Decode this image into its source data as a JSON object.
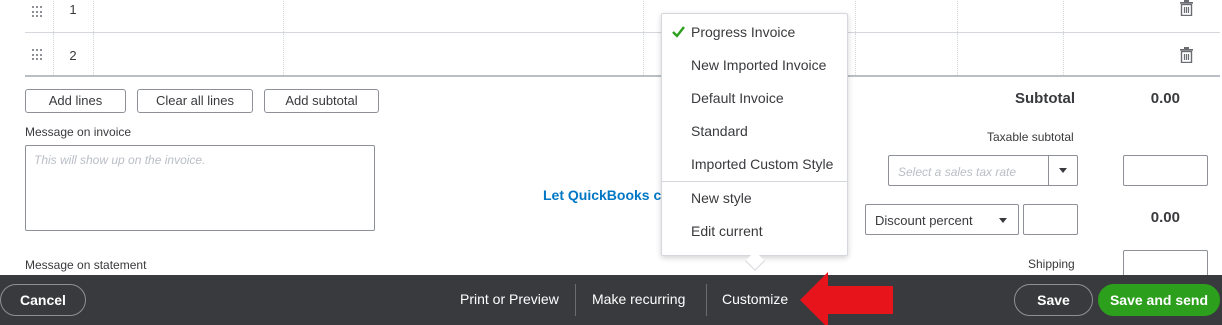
{
  "table": {
    "rows": [
      {
        "num": "1"
      },
      {
        "num": "2"
      }
    ]
  },
  "actions": {
    "add_lines": "Add lines",
    "clear_all_lines": "Clear all lines",
    "add_subtotal": "Add subtotal"
  },
  "message_invoice": {
    "label": "Message on invoice",
    "placeholder": "This will show up on the invoice."
  },
  "message_statement": {
    "label": "Message on statement"
  },
  "promo_link": "Let QuickBooks ca",
  "totals": {
    "subtotal_label": "Subtotal",
    "subtotal_value": "0.00",
    "taxable_label": "Taxable subtotal",
    "tax_rate_placeholder": "Select a sales tax rate",
    "discount_type": "Discount percent",
    "discount_value": "0.00",
    "shipping_label": "Shipping"
  },
  "customize_menu": {
    "items": [
      {
        "label": "Progress Invoice",
        "selected": true
      },
      {
        "label": "New Imported Invoice",
        "selected": false
      },
      {
        "label": "Default Invoice",
        "selected": false
      },
      {
        "label": "Standard",
        "selected": false
      },
      {
        "label": "Imported Custom Style",
        "selected": false
      },
      {
        "label": "New style",
        "selected": false
      },
      {
        "label": "Edit current",
        "selected": false
      }
    ]
  },
  "footer": {
    "cancel": "Cancel",
    "print_preview": "Print or Preview",
    "make_recurring": "Make recurring",
    "customize": "Customize",
    "save": "Save",
    "save_and_send": "Save and send"
  },
  "colors": {
    "accent_green": "#2ca01c",
    "link_blue": "#0077c5",
    "footer_bg": "#393a3d",
    "annotation_red": "#e8141c"
  }
}
